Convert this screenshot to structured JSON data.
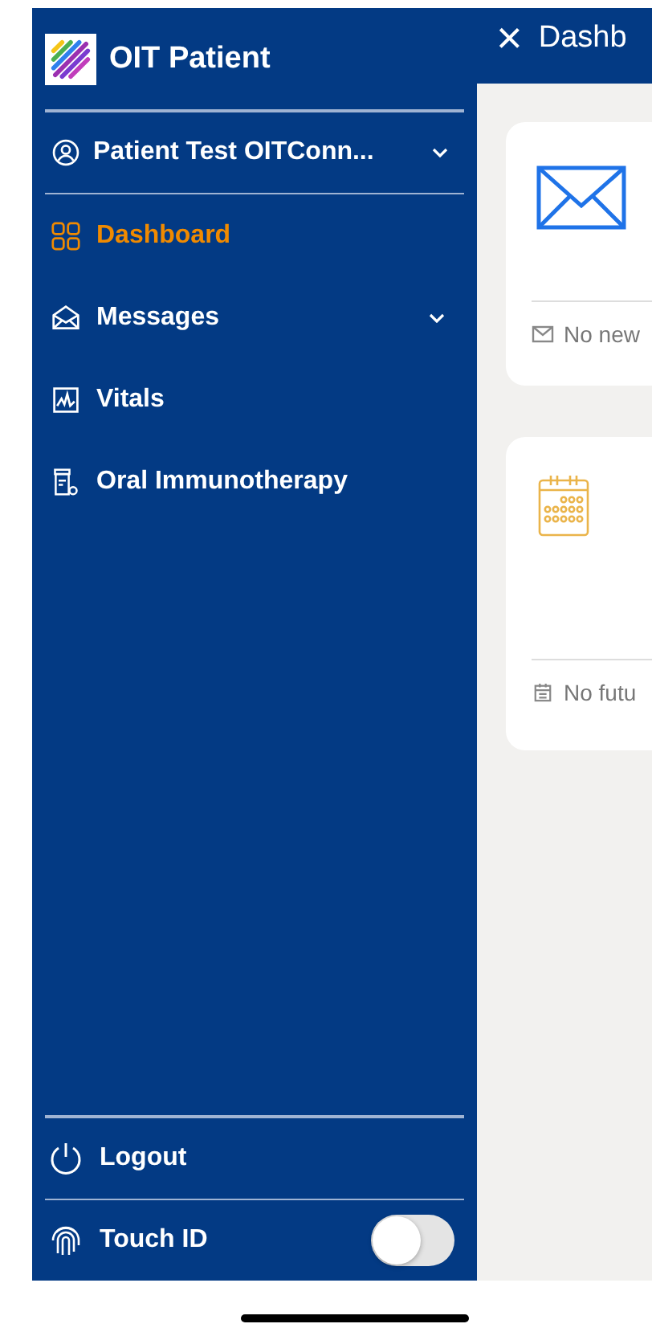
{
  "app": {
    "title": "OIT Patient"
  },
  "user": {
    "name": "Patient Test OITConn...",
    "expanded": false
  },
  "menu": [
    {
      "label": "Dashboard",
      "selected": true,
      "expandable": false
    },
    {
      "label": "Messages",
      "selected": false,
      "expandable": true
    },
    {
      "label": "Vitals",
      "selected": false,
      "expandable": false
    },
    {
      "label": "Oral Immunotherapy",
      "selected": false,
      "expandable": false
    }
  ],
  "logout": {
    "label": "Logout"
  },
  "touch_id": {
    "label": "Touch ID",
    "on": false
  },
  "header": {
    "close": "×",
    "title": "Dashb"
  },
  "cards": [
    {
      "kind": "messages",
      "footer": "No new"
    },
    {
      "kind": "appointments",
      "footer": "No futu"
    }
  ]
}
